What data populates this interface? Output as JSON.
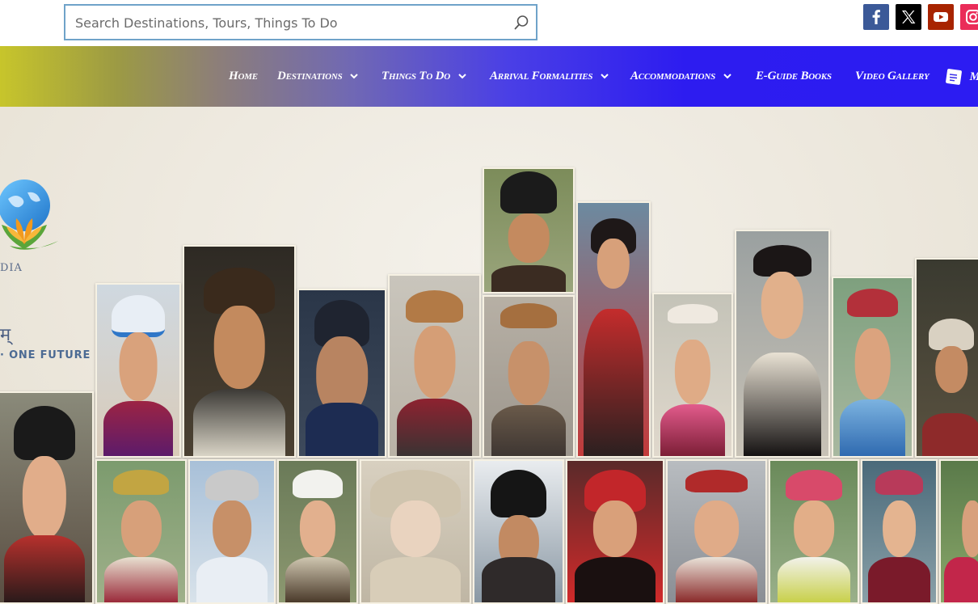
{
  "search": {
    "placeholder": "Search Destinations, Tours, Things To Do",
    "value": ""
  },
  "social": [
    {
      "name": "facebook-icon",
      "color": "#3b5998"
    },
    {
      "name": "x-icon",
      "color": "#000000"
    },
    {
      "name": "youtube-icon",
      "color": "#a82400"
    },
    {
      "name": "instagram-icon",
      "color": "#ea2c59"
    }
  ],
  "nav": {
    "items": [
      {
        "label": "Home",
        "dropdown": false
      },
      {
        "label": "Destinations",
        "dropdown": true
      },
      {
        "label": "Things To Do",
        "dropdown": true
      },
      {
        "label": "Arrival Formalities",
        "dropdown": true
      },
      {
        "label": "Accommodations",
        "dropdown": true
      },
      {
        "label": "E-Guide Books",
        "dropdown": false
      },
      {
        "label": "Video Gallery",
        "dropdown": false
      }
    ],
    "menu_label": "M",
    "colors": {
      "start": "#c7c52b",
      "end": "#2c1cf2"
    }
  },
  "hero": {
    "logo_caption": "DIA",
    "hindi_text": "म्",
    "motto": "· ONE FUTURE"
  }
}
